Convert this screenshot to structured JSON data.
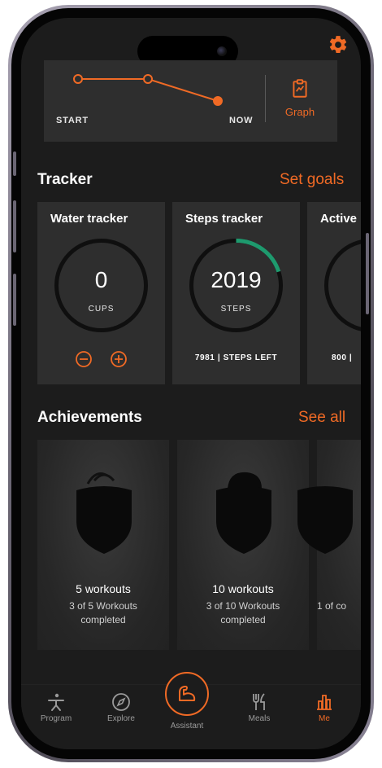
{
  "colors": {
    "accent": "#f06a25",
    "progress": "#1e9a6e",
    "card": "#2e2e2e",
    "background": "#1c1c1c"
  },
  "header": {
    "settings_icon": "gear-icon"
  },
  "graph_card": {
    "start_label": "START",
    "now_label": "NOW",
    "button_label": "Graph",
    "button_icon": "clipboard-icon"
  },
  "tracker": {
    "title": "Tracker",
    "link": "Set goals",
    "cards": [
      {
        "title": "Water tracker",
        "value": "0",
        "unit": "CUPS",
        "progress": 0
      },
      {
        "title": "Steps tracker",
        "value": "2019",
        "unit": "STEPS",
        "footer": "7981 | STEPS LEFT",
        "progress": 0.2
      },
      {
        "title": "Active",
        "footer": "800 |"
      }
    ]
  },
  "achievements": {
    "title": "Achievements",
    "link": "See all",
    "cards": [
      {
        "name": "5 workouts",
        "sub": "3 of 5 Workouts completed"
      },
      {
        "name": "10 workouts",
        "sub": "3 of 10 Workouts completed"
      },
      {
        "name": "",
        "sub": "1 of co"
      }
    ]
  },
  "tabbar": {
    "items": [
      {
        "label": "Program",
        "icon": "person-stretch-icon"
      },
      {
        "label": "Explore",
        "icon": "compass-icon"
      },
      {
        "label": "Assistant",
        "icon": "flexed-arm-icon"
      },
      {
        "label": "Meals",
        "icon": "fork-knife-icon"
      },
      {
        "label": "Me",
        "icon": "bar-chart-icon",
        "active": true
      }
    ]
  }
}
